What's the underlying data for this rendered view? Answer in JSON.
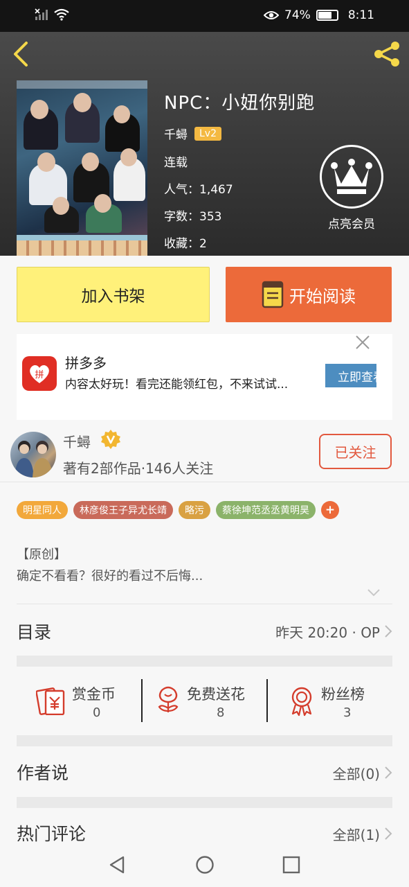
{
  "status_bar": {
    "battery_percent": "74%",
    "time": "8:11",
    "battery_level": 0.74
  },
  "book": {
    "title": "NPC：小妞你别跑",
    "author": "千蟳",
    "level": "Lv2",
    "status": "连载",
    "popularity": "人气：1,467",
    "word_count": "字数：353",
    "favorites": "收藏：2",
    "vip_label": "点亮会员"
  },
  "actions": {
    "add_shelf": "加入书架",
    "start_reading": "开始阅读"
  },
  "ad": {
    "name": "拼多多",
    "description": "内容太好玩！看完还能领红包，不来试试...",
    "cta": "立即查看",
    "logo_text": "拼"
  },
  "author": {
    "name": "千蟳",
    "stats": "著有2部作品·146人关注",
    "follow_label": "已关注"
  },
  "tags": [
    {
      "label": "明星同人",
      "color": "#f2a83b"
    },
    {
      "label": "林彦俊王子异尤长靖",
      "color": "#c96a5a"
    },
    {
      "label": "略污",
      "color": "#d9a142"
    },
    {
      "label": "蔡徐坤范丞丞黄明昊",
      "color": "#8bb36a"
    }
  ],
  "tag_more": "+",
  "description": {
    "line1": "【原创】",
    "line2": "确定不看看？很好的看过不后悔..."
  },
  "catalog": {
    "title": "目录",
    "update": "昨天 20:20 · OP"
  },
  "stats": [
    {
      "label": "赏金币",
      "value": "0",
      "icon": "red-envelope-icon"
    },
    {
      "label": "免费送花",
      "value": "8",
      "icon": "flower-icon"
    },
    {
      "label": "粉丝榜",
      "value": "3",
      "icon": "medal-icon"
    }
  ],
  "author_say": {
    "title": "作者说",
    "count": "全部(0)"
  },
  "hot_comments": {
    "title": "热门评论",
    "count": "全部(1)"
  },
  "colors": {
    "accent_orange": "#ec6a3a",
    "shelf_yellow": "#fff17a",
    "follow_red": "#e2583e",
    "back_yellow": "#f5d84a"
  }
}
